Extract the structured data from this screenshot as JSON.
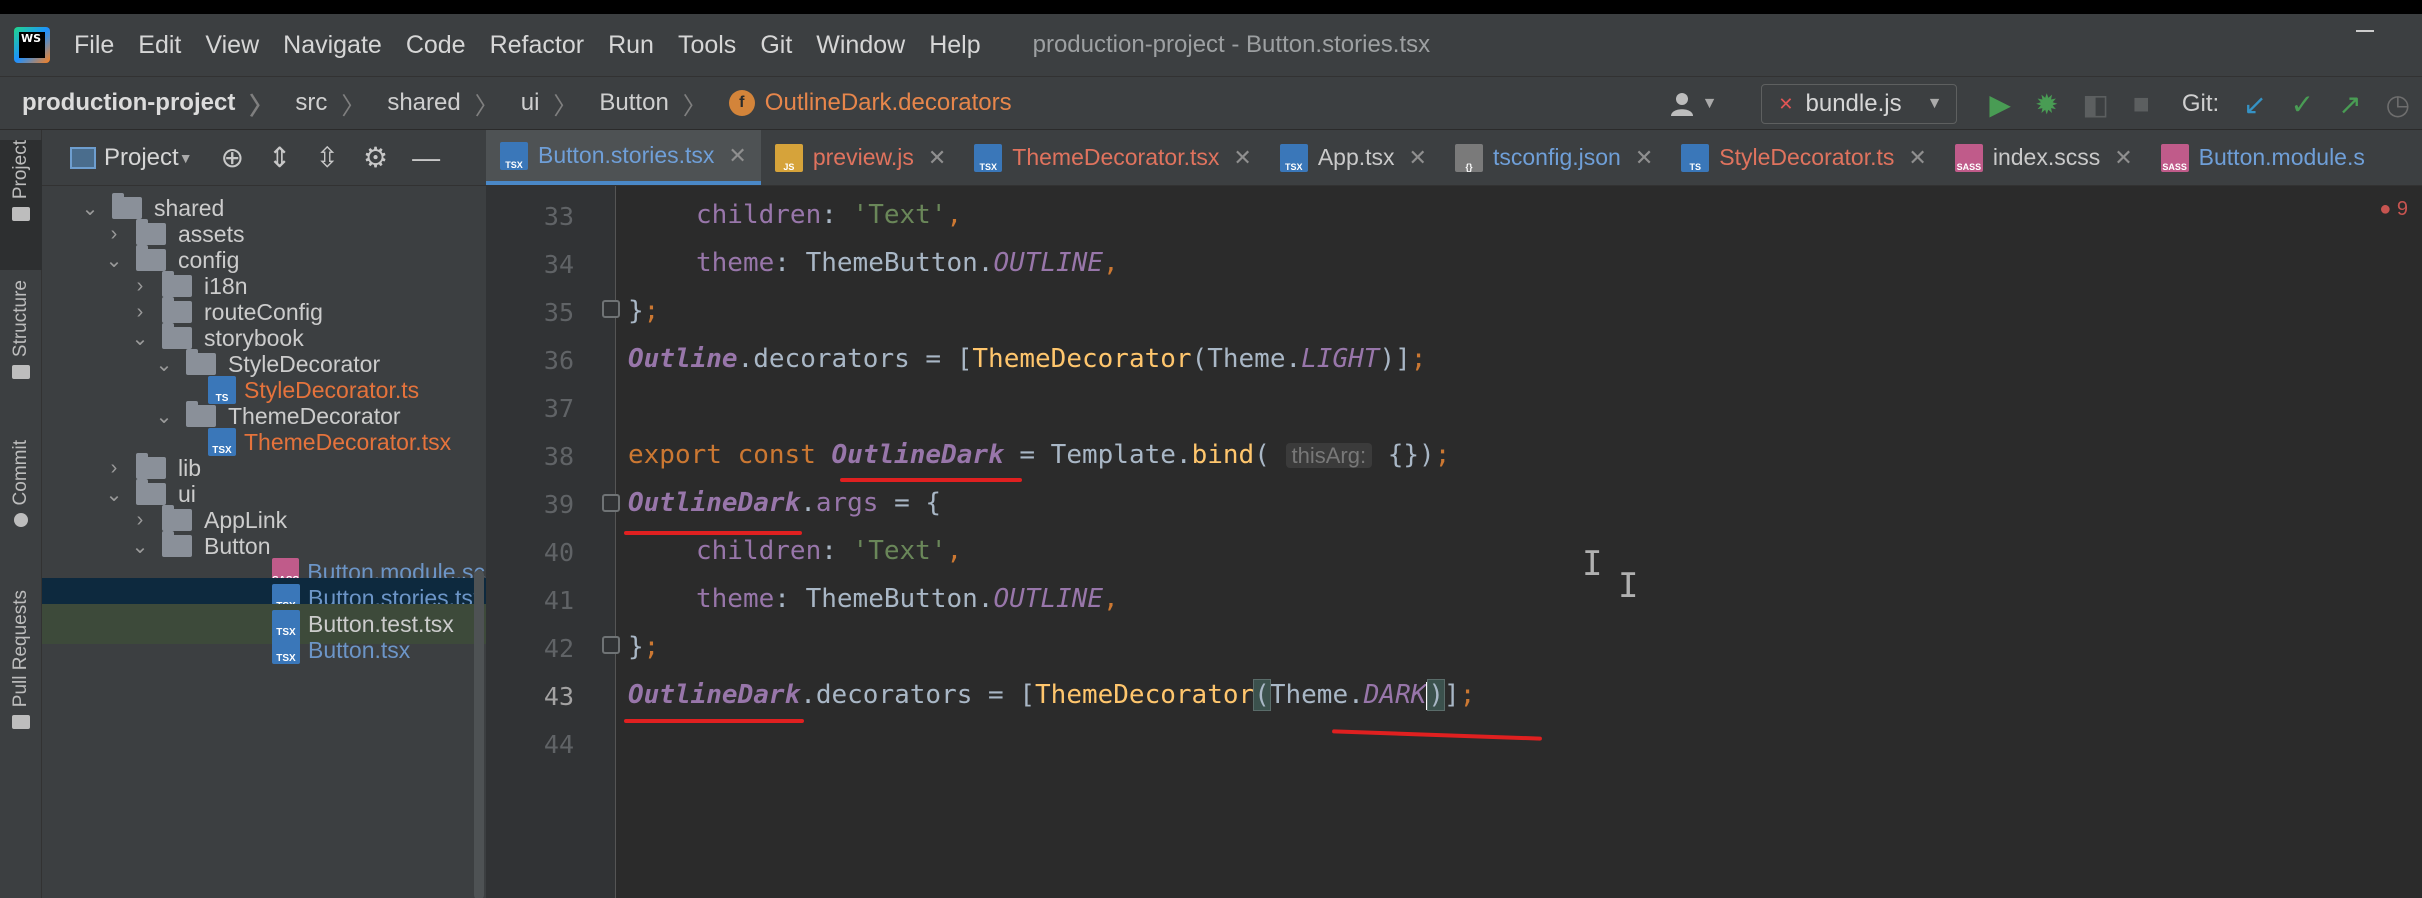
{
  "menu": {
    "items": [
      "File",
      "Edit",
      "View",
      "Navigate",
      "Code",
      "Refactor",
      "Run",
      "Tools",
      "Git",
      "Window",
      "Help"
    ],
    "window_title": "production-project - Button.stories.tsx"
  },
  "breadcrumb": {
    "items": [
      "production-project",
      "src",
      "shared",
      "ui",
      "Button"
    ],
    "current": "OutlineDark.decorators"
  },
  "toolbar": {
    "run_config": "bundle.js",
    "git_label": "Git:"
  },
  "toolstrip": {
    "tabs": [
      "Project",
      "Structure",
      "Commit",
      "Pull Requests"
    ]
  },
  "project_panel": {
    "title": "Project",
    "tree": [
      {
        "label": "shared",
        "type": "folder",
        "expanded": true
      },
      {
        "label": "assets",
        "type": "folder",
        "expanded": false
      },
      {
        "label": "config",
        "type": "folder",
        "expanded": true
      },
      {
        "label": "i18n",
        "type": "folder",
        "expanded": false
      },
      {
        "label": "routeConfig",
        "type": "folder",
        "expanded": false
      },
      {
        "label": "storybook",
        "type": "folder",
        "expanded": true
      },
      {
        "label": "StyleDecorator",
        "type": "folder",
        "expanded": true
      },
      {
        "label": "StyleDecorator.ts",
        "type": "file"
      },
      {
        "label": "ThemeDecorator",
        "type": "folder",
        "expanded": true
      },
      {
        "label": "ThemeDecorator.tsx",
        "type": "file"
      },
      {
        "label": "lib",
        "type": "folder",
        "expanded": false
      },
      {
        "label": "ui",
        "type": "folder",
        "expanded": true
      },
      {
        "label": "AppLink",
        "type": "folder",
        "expanded": false
      },
      {
        "label": "Button",
        "type": "folder",
        "expanded": true
      },
      {
        "label": "Button.module.scss",
        "type": "file"
      },
      {
        "label": "Button.stories.tsx",
        "type": "file"
      },
      {
        "label": "Button.test.tsx",
        "type": "file"
      },
      {
        "label": "Button.tsx",
        "type": "file"
      }
    ]
  },
  "editor_tabs": [
    {
      "label": "Button.stories.tsx",
      "badge": "TSX",
      "active": true
    },
    {
      "label": "preview.js",
      "badge": "JS"
    },
    {
      "label": "ThemeDecorator.tsx",
      "badge": "TSX"
    },
    {
      "label": "App.tsx",
      "badge": "TSX"
    },
    {
      "label": "tsconfig.json",
      "badge": "{}"
    },
    {
      "label": "StyleDecorator.ts",
      "badge": "TS"
    },
    {
      "label": "index.scss",
      "badge": "SASS"
    },
    {
      "label": "Button.module.s",
      "badge": "SASS"
    }
  ],
  "editor": {
    "problems_count": "9",
    "current_line": 43,
    "lines": [
      {
        "n": "33",
        "code": "children: 'Text',"
      },
      {
        "n": "34",
        "code": "theme: ThemeButton.OUTLINE,"
      },
      {
        "n": "35",
        "code": "};"
      },
      {
        "n": "36",
        "code": "Outline.decorators = [ThemeDecorator(Theme.LIGHT)];"
      },
      {
        "n": "37",
        "code": ""
      },
      {
        "n": "38",
        "code": "export const OutlineDark = Template.bind( thisArg: {});"
      },
      {
        "n": "39",
        "code": "OutlineDark.args = {"
      },
      {
        "n": "40",
        "code": "children: 'Text',"
      },
      {
        "n": "41",
        "code": "theme: ThemeButton.OUTLINE,"
      },
      {
        "n": "42",
        "code": "};"
      },
      {
        "n": "43",
        "code": "OutlineDark.decorators = [ThemeDecorator(Theme.DARK)];"
      },
      {
        "n": "44",
        "code": ""
      }
    ],
    "tokens": {
      "children": "children",
      "text_str": "'Text'",
      "theme": "theme",
      "ThemeButton": "ThemeButton",
      "OUTLINE": "OUTLINE",
      "Outline": "Outline",
      "decorators": "decorators",
      "ThemeDecorator": "ThemeDecorator",
      "Theme": "Theme",
      "LIGHT": "LIGHT",
      "DARK": "DARK",
      "export": "export",
      "const": "const",
      "OutlineDark": "OutlineDark",
      "Template": "Template",
      "bind": "bind",
      "thisArg": "thisArg:",
      "args": "args"
    }
  },
  "colors": {
    "accent": "#4a88c7",
    "annotation": "#e02020"
  }
}
